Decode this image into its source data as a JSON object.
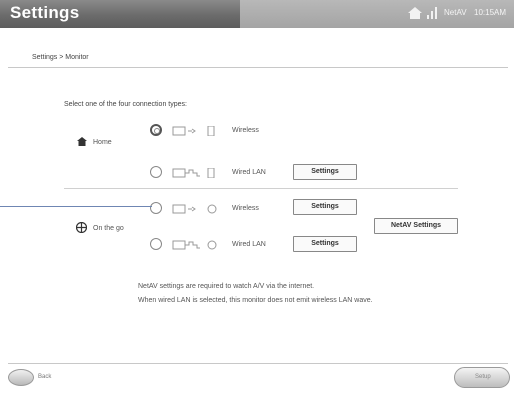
{
  "header": {
    "title": "Settings",
    "status_text": "NetAV",
    "time": "10:15AM"
  },
  "breadcrumb": "Settings > Monitor",
  "prompt": "Select one of the four connection types:",
  "groups": [
    {
      "label": "Home",
      "icon": "home-icon"
    },
    {
      "label": "On the go",
      "icon": "outdoor-icon"
    }
  ],
  "options": [
    {
      "label": "Wireless",
      "selected": true,
      "has_settings": false
    },
    {
      "label": "Wired LAN",
      "selected": false,
      "has_settings": true
    },
    {
      "label": "Wireless",
      "selected": false,
      "has_settings": true
    },
    {
      "label": "Wired LAN",
      "selected": false,
      "has_settings": true
    }
  ],
  "buttons": {
    "settings": "Settings",
    "netav_settings": "NetAV Settings"
  },
  "notes": [
    "NetAV settings are required to watch A/V via the internet.",
    "When wired LAN is selected, this monitor does not emit wireless LAN wave."
  ],
  "footer": {
    "back_label": "Back",
    "setup_label": "Setup"
  },
  "colors": {
    "title_bar": "#6b6b6b",
    "pointer_line": "#6f86b3"
  }
}
